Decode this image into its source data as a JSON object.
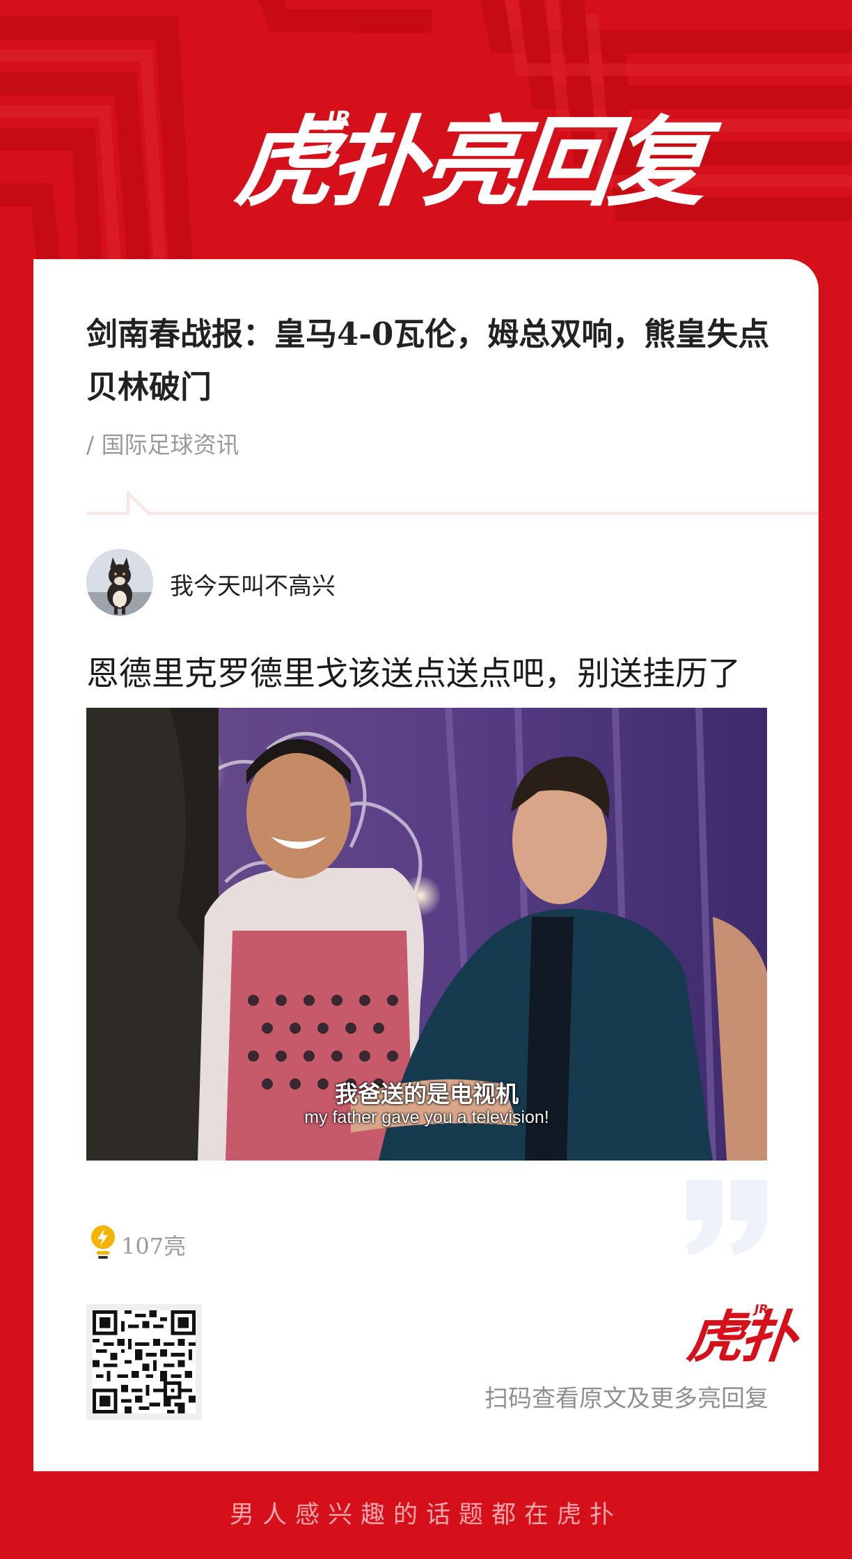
{
  "colors": {
    "brand_red": "#d5101a",
    "card_bg": "#ffffff",
    "muted_text": "#9a9a9a",
    "footer_text": "#f4a7ab"
  },
  "header": {
    "logo_text": "虎扑亮回复",
    "logo_superscript": "JR",
    "logo_icon": "lightning-bulb-icon"
  },
  "post": {
    "title": "剑南春战报：皇马4-0瓦伦，姆总双响，熊皇失点贝林破门",
    "category": "/ 国际足球资讯"
  },
  "reply": {
    "author": "我今天叫不高兴",
    "avatar_icon": "shiba-dog-avatar",
    "text": "恩德里克罗德里戈该送点送点吧，别送挂历了",
    "image_subtitle_cn": "我爸送的是电视机",
    "image_subtitle_en": "my father gave you a television!",
    "likes": "107亮",
    "likes_icon": "lightbulb-icon"
  },
  "share": {
    "qr_icon": "qr-code",
    "brand_text": "虎扑",
    "brand_superscript": "JR",
    "scan_text": "扫码查看原文及更多亮回复"
  },
  "footer": {
    "slogan": "男人感兴趣的话题都在虎扑"
  }
}
